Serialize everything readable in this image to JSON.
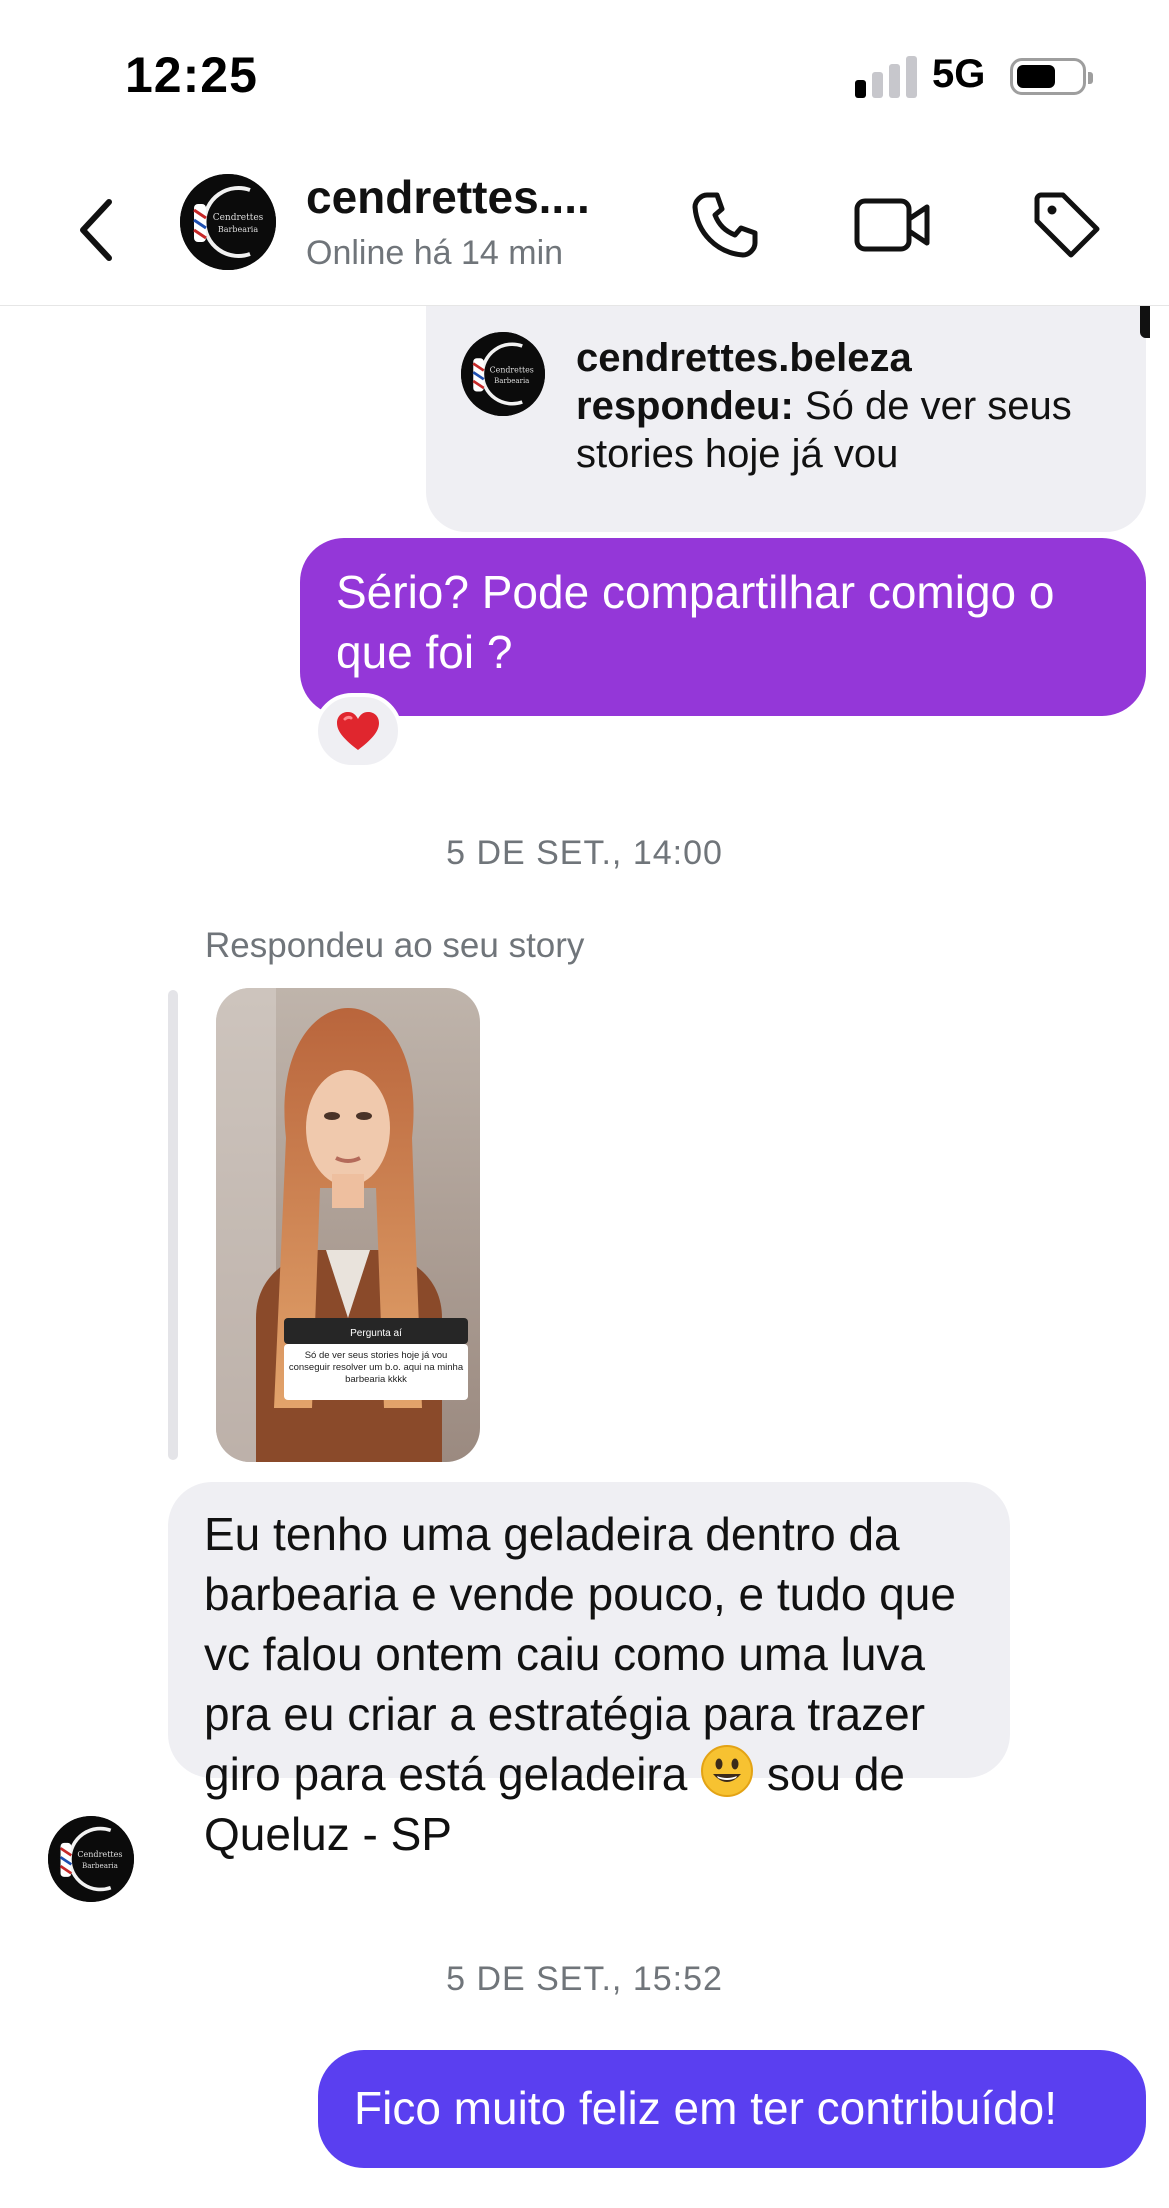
{
  "status_bar": {
    "time": "12:25",
    "network": "5G",
    "signal_bars_on": 1,
    "signal_bars_total": 4,
    "battery_level": 0.5
  },
  "header": {
    "contact_name": "cendrettes....",
    "contact_status": "Online há 14 min",
    "avatar_text_line1": "Cendrettes",
    "avatar_text_line2": "Barbearia",
    "icons": [
      "back-chevron-icon",
      "phone-icon",
      "video-camera-icon",
      "tag-icon"
    ]
  },
  "messages": {
    "reply_card": {
      "author": "cendrettes.beleza",
      "verb": "respondeu:",
      "text": "Só de ver seus stories hoje já vou"
    },
    "outgoing_1": {
      "text": "Sério? Pode compartilhar comigo o que foi ?",
      "reaction": "❤️"
    },
    "date_1": "5 DE SET., 14:00",
    "story_reply": {
      "label": "Respondeu ao seu story",
      "question_title": "Pergunta aí",
      "question_text": "Só de ver seus stories hoje já vou conseguir resolver um b.o. aqui na minha barbearia kkkk"
    },
    "incoming_1": {
      "text_before_emoji": "Eu tenho uma geladeira dentro da barbearia e vende pouco, e tudo que vc falou ontem caiu como uma luva pra eu criar a estratégia para trazer giro para está geladeira",
      "emoji": "smiling-face-icon",
      "text_after_emoji": "sou de Queluz - SP"
    },
    "date_2": "5 DE SET., 15:52",
    "outgoing_2": {
      "text": "Fico muito feliz em ter contribuído!"
    }
  },
  "colors": {
    "outgoing_purple": "#9437d8",
    "outgoing_blue": "#5a3ff0",
    "incoming_gray": "#efeff3",
    "muted_text": "#70757a"
  }
}
